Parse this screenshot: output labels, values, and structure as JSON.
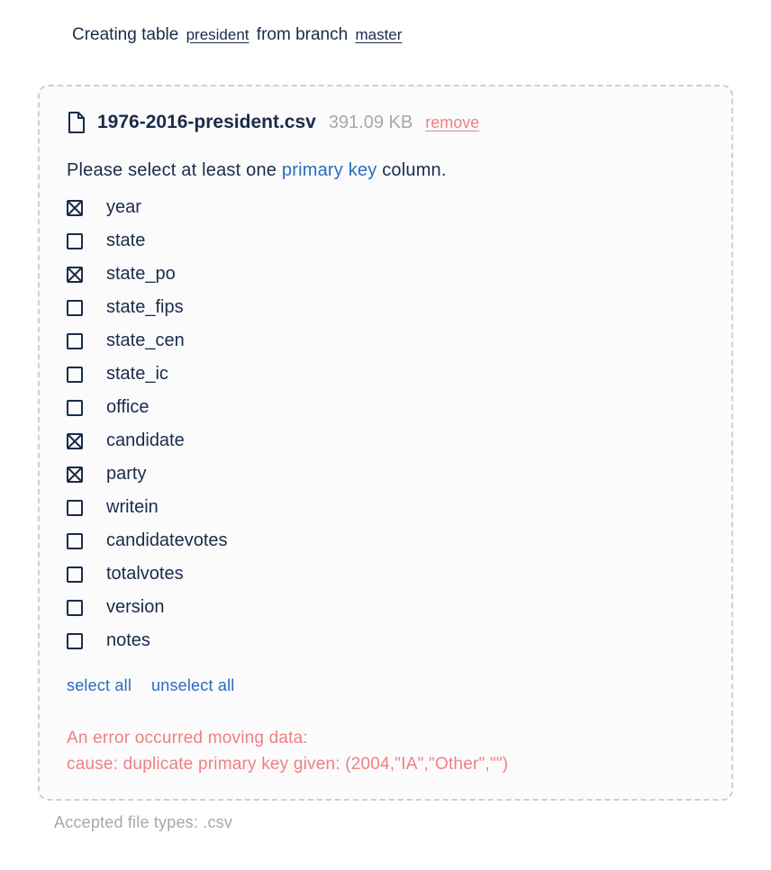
{
  "header": {
    "prefix": "Creating table",
    "table_name": "president",
    "middle": "from branch",
    "branch_name": "master"
  },
  "file": {
    "name": "1976-2016-president.csv",
    "size": "391.09 KB",
    "remove_label": "remove"
  },
  "instruction": {
    "before": "Please select at least one ",
    "pk": "primary key",
    "after": " column."
  },
  "columns": [
    {
      "name": "year",
      "checked": true
    },
    {
      "name": "state",
      "checked": false
    },
    {
      "name": "state_po",
      "checked": true
    },
    {
      "name": "state_fips",
      "checked": false
    },
    {
      "name": "state_cen",
      "checked": false
    },
    {
      "name": "state_ic",
      "checked": false
    },
    {
      "name": "office",
      "checked": false
    },
    {
      "name": "candidate",
      "checked": true
    },
    {
      "name": "party",
      "checked": true
    },
    {
      "name": "writein",
      "checked": false
    },
    {
      "name": "candidatevotes",
      "checked": false
    },
    {
      "name": "totalvotes",
      "checked": false
    },
    {
      "name": "version",
      "checked": false
    },
    {
      "name": "notes",
      "checked": false
    }
  ],
  "actions": {
    "select_all": "select all",
    "unselect_all": "unselect all"
  },
  "error": {
    "line1": "An error occurred moving data:",
    "line2": "cause: duplicate primary key given: (2004,\"IA\",\"Other\",\"\")"
  },
  "footer": "Accepted file types: .csv"
}
